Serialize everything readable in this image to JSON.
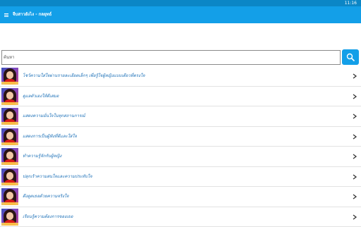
{
  "status_bar": {
    "time": "11:16"
  },
  "app_bar": {
    "title": "จีบสาวยังไง - กลยุทธ์",
    "menu_icon": "hamburger-menu-icon"
  },
  "search": {
    "placeholder": "ค้นหา",
    "value": "",
    "button_icon": "search-icon"
  },
  "colors": {
    "accent": "#139fe8",
    "status_bar": "#0b86c6",
    "link_text": "#1a6fb7"
  },
  "list": {
    "items": [
      {
        "label": "โชว์ความใส่ใจผ่านรายละเอียดเล็กๆ เพื่อรู้ใจผู้หญิงแบบเดียวที่ตรงใจ",
        "icon": "chevron-right-icon"
      },
      {
        "label": "ดูแลตัวเองให้ดีเสมอ",
        "icon": "chevron-right-icon"
      },
      {
        "label": "แสดงความมั่นใจในทุกสถานการณ์",
        "icon": "chevron-right-icon"
      },
      {
        "label": "แสดงการเป็นผู้ฟังที่ดีและใส่ใจ",
        "icon": "chevron-right-icon"
      },
      {
        "label": "ทำความรู้จักกับผู้หญิง",
        "icon": "chevron-right-icon"
      },
      {
        "label": "ปลุกเร้าความสนใจและความประทับใจ",
        "icon": "chevron-right-icon"
      },
      {
        "label": "ดึงดูดเธอด้วยความจริงใจ",
        "icon": "chevron-right-icon"
      },
      {
        "label": "เรียนรู้ความต้องการของเธอ",
        "icon": "chevron-right-icon"
      }
    ]
  }
}
